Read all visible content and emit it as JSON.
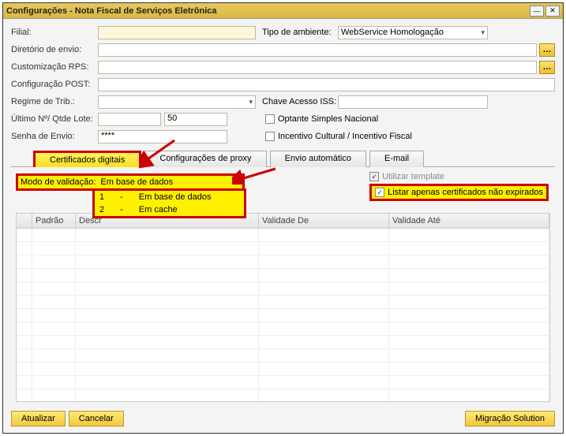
{
  "title": "Configurações - Nota Fiscal de Serviços Eletrônica",
  "form": {
    "filial_label": "Filial:",
    "tipo_ambiente_label": "Tipo de ambiente:",
    "tipo_ambiente_value": "WebService Homologação",
    "diretorio_envio_label": "Diretório de envio:",
    "customizacao_rps_label": "Customização RPS:",
    "configuracao_post_label": "Configuração POST:",
    "regime_trib_label": "Regime de Trib.:",
    "chave_acesso_label": "Chave Acesso ISS:",
    "ultimo_lote_label": "Último Nº/ Qtde  Lote:",
    "ultimo_lote_qtde": "50",
    "optante_simples_label": "Optante Simples Nacional",
    "senha_envio_label": "Senha de Envio:",
    "senha_envio_value": "****",
    "incentivo_label": "Incentivo Cultural / Incentivo Fiscal"
  },
  "tabs": {
    "certificados": "Certificados digitais",
    "proxy": "Configurações de proxy",
    "envio": "Envio automático",
    "email": "E-mail"
  },
  "modo": {
    "label": "Modo de validação:",
    "value": "Em base de dados",
    "options": [
      {
        "n": "1",
        "dash": "-",
        "text": "Em base de dados"
      },
      {
        "n": "2",
        "dash": "-",
        "text": "Em cache"
      }
    ]
  },
  "rightchecks": {
    "utilizar_template": "Utilizar template",
    "listar_nao_expirados": "Listar apenas certificados não expirados"
  },
  "grid": {
    "cols": {
      "padrao": "Padrão",
      "descricao": "Descr",
      "validade_de": "Validade De",
      "validade_ate": "Validade Até"
    }
  },
  "footer": {
    "atualizar": "Atualizar",
    "cancelar": "Cancelar",
    "migracao": "Migração Solution"
  }
}
